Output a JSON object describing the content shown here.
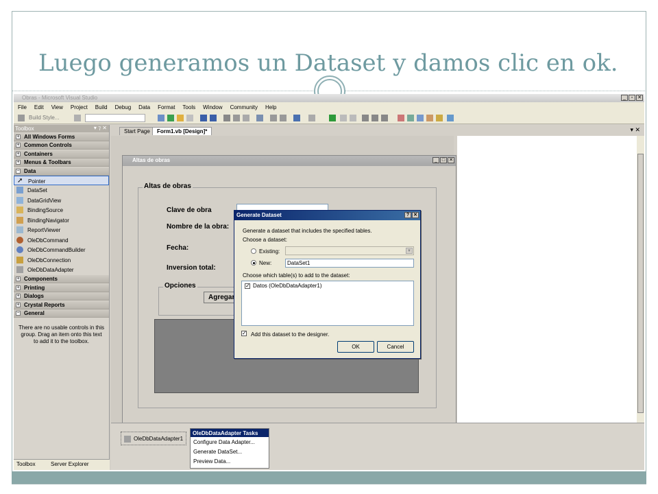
{
  "slide": {
    "title": "Luego generamos un Dataset y damos clic en ok."
  },
  "app": {
    "window_title": "Obras - Microsoft Visual Studio",
    "menu": [
      "File",
      "Edit",
      "View",
      "Project",
      "Build",
      "Debug",
      "Data",
      "Format",
      "Tools",
      "Window",
      "Community",
      "Help"
    ],
    "toolbar_build_style": "Build Style..."
  },
  "toolbox": {
    "title": "Toolbox",
    "header_controls": "▾ ⁊ ✕",
    "categories_top": [
      {
        "label": "All Windows Forms",
        "sign": "+"
      },
      {
        "label": "Common Controls",
        "sign": "+"
      },
      {
        "label": "Containers",
        "sign": "+"
      },
      {
        "label": "Menus & Toolbars",
        "sign": "+"
      },
      {
        "label": "Data",
        "sign": "−"
      }
    ],
    "data_items": [
      "Pointer",
      "DataSet",
      "DataGridView",
      "BindingSource",
      "BindingNavigator",
      "ReportViewer",
      "OleDbCommand",
      "OleDbCommandBuilder",
      "OleDbConnection",
      "OleDbDataAdapter"
    ],
    "categories_bottom": [
      {
        "label": "Components",
        "sign": "+"
      },
      {
        "label": "Printing",
        "sign": "+"
      },
      {
        "label": "Dialogs",
        "sign": "+"
      },
      {
        "label": "Crystal Reports",
        "sign": "+"
      },
      {
        "label": "General",
        "sign": "−"
      }
    ],
    "general_message": "There are no usable controls in this group. Drag an item onto this text to add it to the toolbox.",
    "footer_tabs": [
      "Toolbox",
      "Server Explorer"
    ]
  },
  "document": {
    "tabs": [
      "Start Page",
      "Form1.vb [Design]*"
    ],
    "tab_controls": "▾ ✕"
  },
  "form": {
    "title": "Altas de obras",
    "group_title": "Altas de obras",
    "labels": [
      "Clave de obra",
      "Nombre de la obra:",
      "Fecha:",
      "Inversion total:"
    ],
    "options_group": "Opciones",
    "add_button": "Agregar"
  },
  "tray": {
    "component": "OleDbDataAdapter1"
  },
  "dialog": {
    "title": "Generate Dataset",
    "title_buttons": [
      "?",
      "✕"
    ],
    "description": "Generate a dataset that includes the specified tables.",
    "choose_label": "Choose a dataset:",
    "existing_label": "Existing:",
    "new_label": "New:",
    "new_value": "DataSet1",
    "tables_label": "Choose which table(s) to add to the dataset:",
    "table_item": "Datos (OleDbDataAdapter1)",
    "add_designer": "Add this dataset to the designer.",
    "ok": "OK",
    "cancel": "Cancel"
  },
  "tasks_menu": {
    "title": "OleDbDataAdapter Tasks",
    "items": [
      "Configure Data Adapter...",
      "Generate DataSet...",
      "Preview Data..."
    ]
  }
}
